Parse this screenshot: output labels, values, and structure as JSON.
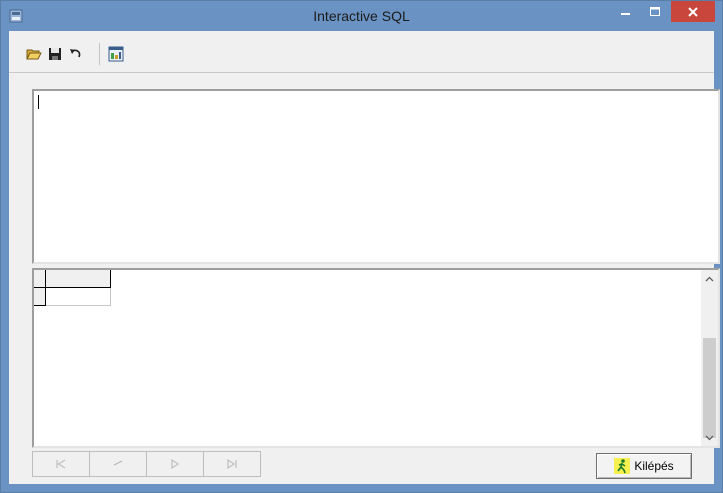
{
  "window": {
    "title": "Interactive SQL"
  },
  "toolbar": {
    "items": [
      {
        "name": "open",
        "icon": "folder-open-icon"
      },
      {
        "name": "save",
        "icon": "floppy-disk-icon"
      },
      {
        "name": "undo",
        "icon": "undo-arrow-icon"
      },
      {
        "name": "run",
        "icon": "execute-query-icon"
      }
    ]
  },
  "editor": {
    "value": ""
  },
  "grid": {
    "columns": [
      ""
    ],
    "rows": [
      [
        ""
      ]
    ]
  },
  "navigator": {
    "buttons": [
      {
        "name": "first",
        "glyph": "|◁"
      },
      {
        "name": "prior",
        "glyph": "◁"
      },
      {
        "name": "next",
        "glyph": "▷"
      },
      {
        "name": "last",
        "glyph": "▷|"
      }
    ]
  },
  "exit_button": {
    "label": "Kilépés"
  },
  "colors": {
    "titlebar": "#6a93c4",
    "close_button": "#c8463c",
    "client_bg": "#f0f0f0"
  }
}
